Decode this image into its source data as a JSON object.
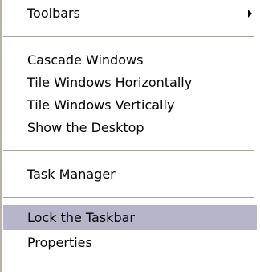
{
  "menu": {
    "toolbars": "Toolbars",
    "cascade": "Cascade Windows",
    "tile_h": "Tile Windows Horizontally",
    "tile_v": "Tile Windows Vertically",
    "show_desktop": "Show the Desktop",
    "task_manager": "Task Manager",
    "lock_taskbar": "Lock the Taskbar",
    "properties": "Properties"
  },
  "colors": {
    "highlight": "#b6b5c9",
    "separator": "#a7a49c"
  },
  "icons": {
    "submenu_arrow": "triangle-right"
  }
}
